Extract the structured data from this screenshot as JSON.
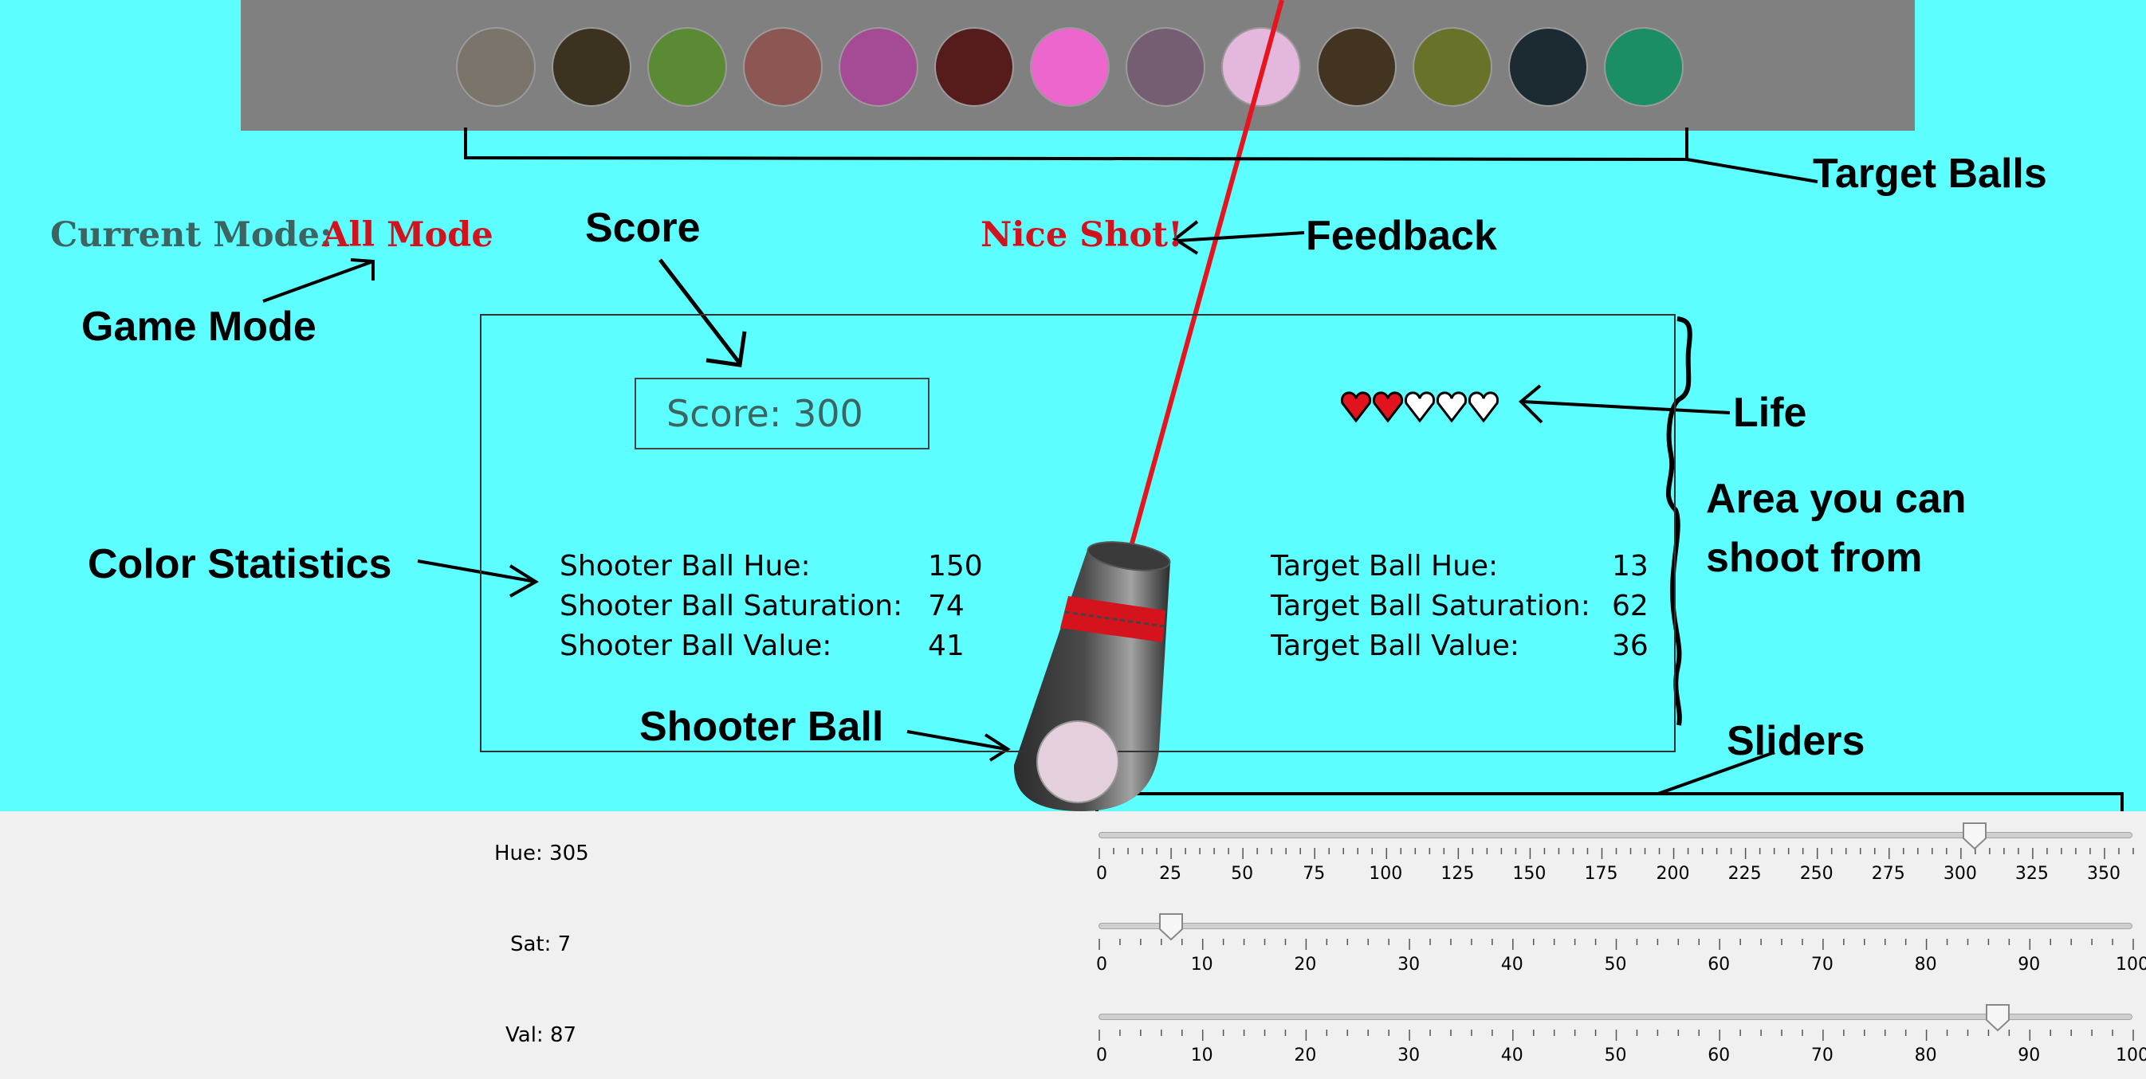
{
  "target_balls": [
    {
      "color": "#7b746b"
    },
    {
      "color": "#3b3220"
    },
    {
      "color": "#5a8a33"
    },
    {
      "color": "#8c5752"
    },
    {
      "color": "#a54b96"
    },
    {
      "color": "#561c1c"
    },
    {
      "color": "#ec66ce"
    },
    {
      "color": "#765e72"
    },
    {
      "color": "#e4b7dc"
    },
    {
      "color": "#433422"
    },
    {
      "color": "#6a7129"
    },
    {
      "color": "#1c2b32"
    },
    {
      "color": "#1b8e63"
    }
  ],
  "mode": {
    "label": "Current Mode:",
    "value": "All Mode"
  },
  "feedback": "Nice Shot!",
  "score_text": "Score: 300",
  "lives": {
    "total": 5,
    "filled": 2,
    "filled_color": "#e2131d",
    "empty_color": "#ffffff"
  },
  "shooter_stats": [
    {
      "label": "Shooter Ball Hue:",
      "value": "150"
    },
    {
      "label": "Shooter Ball Saturation:",
      "value": "74"
    },
    {
      "label": "Shooter Ball Value:",
      "value": "41"
    }
  ],
  "target_stats": [
    {
      "label": "Target Ball Hue:",
      "value": "13"
    },
    {
      "label": "Target Ball Saturation:",
      "value": "62"
    },
    {
      "label": "Target Ball Value:",
      "value": "36"
    }
  ],
  "shooter_ball_color": "#e4cfdc",
  "annotations": {
    "target_balls": "Target Balls",
    "feedback": "Feedback",
    "score": "Score",
    "game_mode": "Game Mode",
    "life": "Life",
    "area_line1": "Area you can",
    "area_line2": "shoot from",
    "color_statistics": "Color Statistics",
    "shooter_ball": "Shooter Ball",
    "sliders": "Sliders"
  },
  "sliders": [
    {
      "id": "hue",
      "label": "Hue: 305",
      "value": 305,
      "min": 0,
      "max": 360,
      "tick_labels": [
        "0",
        "25",
        "50",
        "75",
        "100",
        "125",
        "150",
        "175",
        "200",
        "225",
        "250",
        "275",
        "300",
        "325",
        "350"
      ]
    },
    {
      "id": "sat",
      "label": "Sat: 7",
      "value": 7,
      "min": 0,
      "max": 100,
      "tick_labels": [
        "0",
        "10",
        "20",
        "30",
        "40",
        "50",
        "60",
        "70",
        "80",
        "90",
        "100"
      ]
    },
    {
      "id": "val",
      "label": "Val: 87",
      "value": 87,
      "min": 0,
      "max": 100,
      "tick_labels": [
        "0",
        "10",
        "20",
        "30",
        "40",
        "50",
        "60",
        "70",
        "80",
        "90",
        "100"
      ]
    }
  ],
  "colors": {
    "background": "#5cfeff",
    "target_bar": "#808080",
    "laser": "#e8141d",
    "accent_red": "#d0131d"
  }
}
